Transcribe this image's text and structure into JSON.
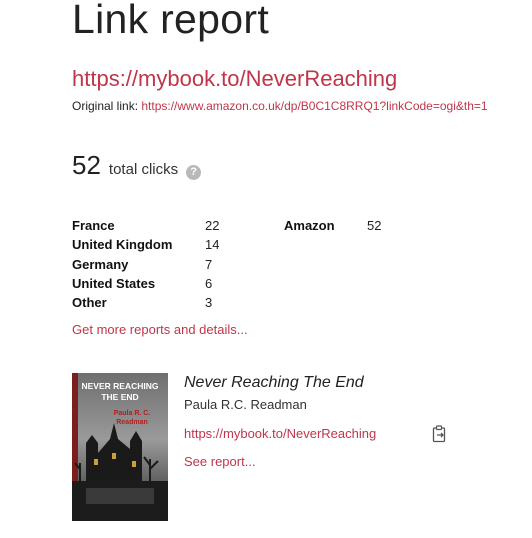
{
  "header": {
    "title": "Link report",
    "short_link": "https://mybook.to/NeverReaching",
    "original_label": "Original link:",
    "original_url": "https://www.amazon.co.uk/dp/B0C1C8RRQ1?linkCode=ogi&th=1"
  },
  "clicks": {
    "total": "52",
    "label": "total clicks",
    "help_icon": "question-circle-icon",
    "help_glyph": "?"
  },
  "countries": [
    {
      "name": "France",
      "count": "22"
    },
    {
      "name": "United Kingdom",
      "count": "14"
    },
    {
      "name": "Germany",
      "count": "7"
    },
    {
      "name": "United States",
      "count": "6"
    },
    {
      "name": "Other",
      "count": "3"
    }
  ],
  "stores": [
    {
      "name": "Amazon",
      "count": "52"
    }
  ],
  "more_link": "Get more reports and details...",
  "book": {
    "title": "Never Reaching The End",
    "author": "Paula R.C. Readman",
    "link": "https://mybook.to/NeverReaching",
    "see_report": "See report...",
    "copy_icon": "clipboard-copy-icon",
    "cover": {
      "title_line1": "NEVER REACHING",
      "title_line2": "THE END",
      "author_line1": "Paula R. C.",
      "author_line2": "Readman"
    }
  },
  "colors": {
    "accent": "#c0354a",
    "text": "#222222",
    "help_icon_bg": "#b9b9b9"
  }
}
